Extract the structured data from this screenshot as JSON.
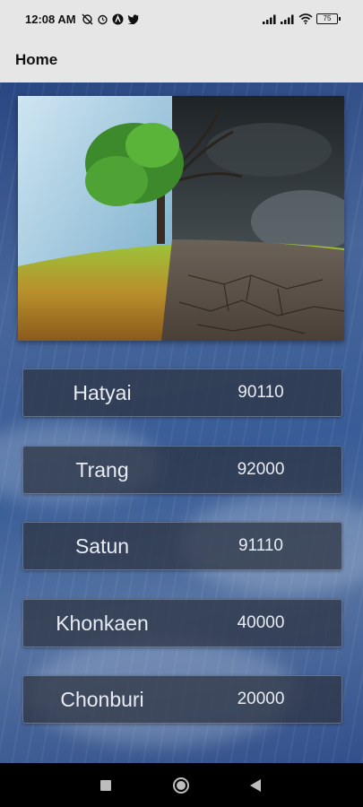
{
  "status_bar": {
    "time": "12:08 AM",
    "battery": "75",
    "icons": [
      "sync-off-icon",
      "alarm-icon",
      "app-a-icon",
      "twitter-icon",
      "signal-icon",
      "signal-icon",
      "wifi-icon",
      "battery-icon"
    ]
  },
  "app_bar": {
    "title": "Home"
  },
  "cities": [
    {
      "name": "Hatyai",
      "code": "90110"
    },
    {
      "name": "Trang",
      "code": "92000"
    },
    {
      "name": "Satun",
      "code": "91110"
    },
    {
      "name": "Khonkaen",
      "code": "40000"
    },
    {
      "name": "Chonburi",
      "code": "20000"
    }
  ],
  "nav": {
    "icons": [
      "square-recents-icon",
      "circle-home-icon",
      "triangle-back-icon"
    ]
  }
}
